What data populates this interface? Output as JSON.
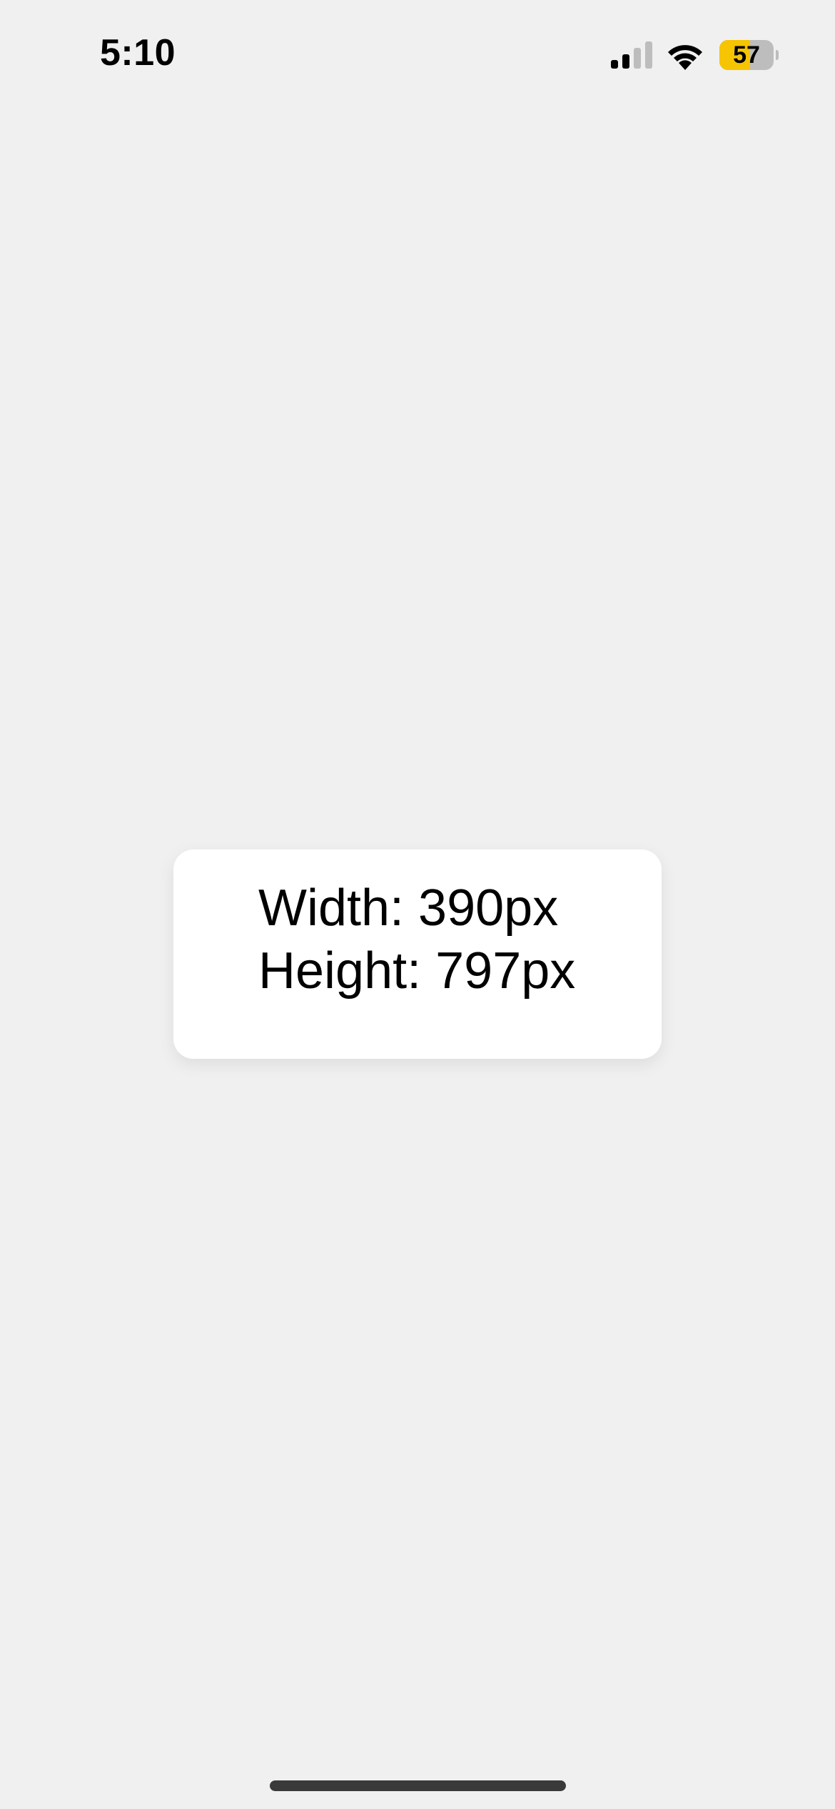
{
  "status_bar": {
    "time": "5:10",
    "signal_icon": "cellular-signal-icon",
    "signal_bars_active": 2,
    "signal_bars_total": 4,
    "wifi_icon": "wifi-icon",
    "battery_icon": "battery-icon",
    "battery_level": "57",
    "battery_fill_fraction": 0.57,
    "battery_color": "#f6c400"
  },
  "info_card": {
    "width_text": "Width: 390px",
    "height_text": "Height: 797px"
  },
  "colors": {
    "background": "#f0f0f0",
    "card": "#ffffff",
    "home_indicator": "#3a3a3a"
  }
}
